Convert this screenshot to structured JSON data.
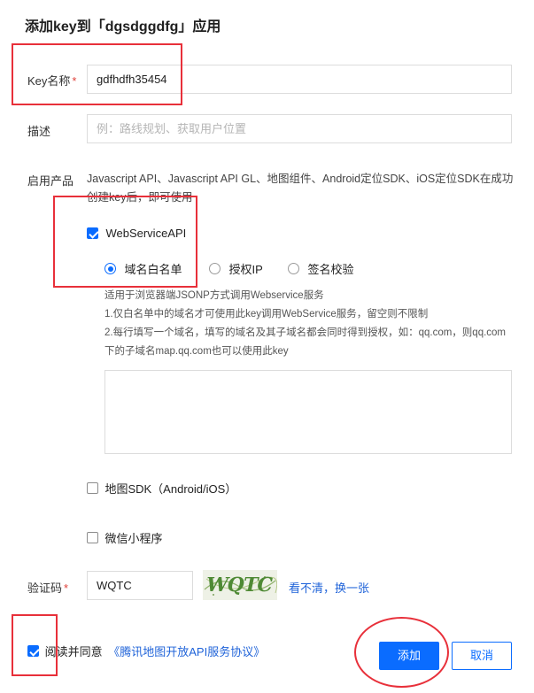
{
  "dialog": {
    "title": "添加key到「dgsdggdfg」应用"
  },
  "key_name": {
    "label": "Key名称",
    "required_mark": "*",
    "value": "gdfhdfh35454"
  },
  "description": {
    "label": "描述",
    "placeholder": "例：路线规划、获取用户位置"
  },
  "products": {
    "label": "启用产品",
    "text": "Javascript API、Javascript API GL、地图组件、Android定位SDK、iOS定位SDK在成功创建key后，即可使用",
    "webservice": {
      "label": "WebServiceAPI",
      "checked": true,
      "auth_options": [
        {
          "label": "域名白名单",
          "selected": true
        },
        {
          "label": "授权IP",
          "selected": false
        },
        {
          "label": "签名校验",
          "selected": false
        }
      ],
      "hint_lines": [
        "适用于浏览器端JSONP方式调用Webservice服务",
        "1.仅白名单中的域名才可使用此key调用WebService服务，留空则不限制",
        "2.每行填写一个域名，填写的域名及其子域名都会同时得到授权，如：qq.com，则qq.com下的子域名map.qq.com也可以使用此key"
      ],
      "whitelist_value": ""
    },
    "map_sdk": {
      "label": "地图SDK（Android/iOS）",
      "checked": false
    },
    "miniprogram": {
      "label": "微信小程序",
      "checked": false
    }
  },
  "captcha": {
    "label": "验证码",
    "required_mark": "*",
    "value": "WQTC",
    "image_text": "WQTC",
    "refresh_link": "看不清，换一张"
  },
  "agreement": {
    "checked": true,
    "prefix": "阅读并同意",
    "link": "《腾讯地图开放API服务协议》"
  },
  "buttons": {
    "add": "添加",
    "cancel": "取消"
  },
  "colors": {
    "primary": "#0a6cff",
    "annotation_red": "#e8303a",
    "link": "#1f63d9"
  }
}
